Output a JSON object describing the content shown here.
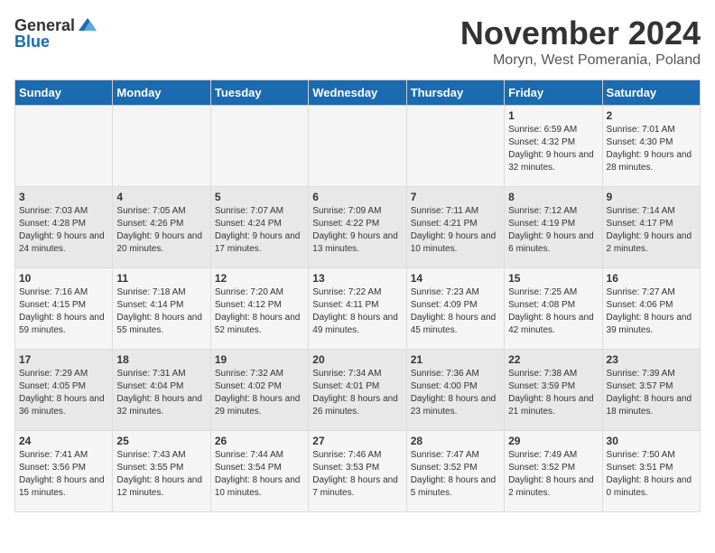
{
  "logo": {
    "text_general": "General",
    "text_blue": "Blue"
  },
  "header": {
    "month_year": "November 2024",
    "location": "Moryn, West Pomerania, Poland"
  },
  "weekdays": [
    "Sunday",
    "Monday",
    "Tuesday",
    "Wednesday",
    "Thursday",
    "Friday",
    "Saturday"
  ],
  "weeks": [
    [
      {
        "day": "",
        "info": ""
      },
      {
        "day": "",
        "info": ""
      },
      {
        "day": "",
        "info": ""
      },
      {
        "day": "",
        "info": ""
      },
      {
        "day": "",
        "info": ""
      },
      {
        "day": "1",
        "info": "Sunrise: 6:59 AM\nSunset: 4:32 PM\nDaylight: 9 hours and 32 minutes."
      },
      {
        "day": "2",
        "info": "Sunrise: 7:01 AM\nSunset: 4:30 PM\nDaylight: 9 hours and 28 minutes."
      }
    ],
    [
      {
        "day": "3",
        "info": "Sunrise: 7:03 AM\nSunset: 4:28 PM\nDaylight: 9 hours and 24 minutes."
      },
      {
        "day": "4",
        "info": "Sunrise: 7:05 AM\nSunset: 4:26 PM\nDaylight: 9 hours and 20 minutes."
      },
      {
        "day": "5",
        "info": "Sunrise: 7:07 AM\nSunset: 4:24 PM\nDaylight: 9 hours and 17 minutes."
      },
      {
        "day": "6",
        "info": "Sunrise: 7:09 AM\nSunset: 4:22 PM\nDaylight: 9 hours and 13 minutes."
      },
      {
        "day": "7",
        "info": "Sunrise: 7:11 AM\nSunset: 4:21 PM\nDaylight: 9 hours and 10 minutes."
      },
      {
        "day": "8",
        "info": "Sunrise: 7:12 AM\nSunset: 4:19 PM\nDaylight: 9 hours and 6 minutes."
      },
      {
        "day": "9",
        "info": "Sunrise: 7:14 AM\nSunset: 4:17 PM\nDaylight: 9 hours and 2 minutes."
      }
    ],
    [
      {
        "day": "10",
        "info": "Sunrise: 7:16 AM\nSunset: 4:15 PM\nDaylight: 8 hours and 59 minutes."
      },
      {
        "day": "11",
        "info": "Sunrise: 7:18 AM\nSunset: 4:14 PM\nDaylight: 8 hours and 55 minutes."
      },
      {
        "day": "12",
        "info": "Sunrise: 7:20 AM\nSunset: 4:12 PM\nDaylight: 8 hours and 52 minutes."
      },
      {
        "day": "13",
        "info": "Sunrise: 7:22 AM\nSunset: 4:11 PM\nDaylight: 8 hours and 49 minutes."
      },
      {
        "day": "14",
        "info": "Sunrise: 7:23 AM\nSunset: 4:09 PM\nDaylight: 8 hours and 45 minutes."
      },
      {
        "day": "15",
        "info": "Sunrise: 7:25 AM\nSunset: 4:08 PM\nDaylight: 8 hours and 42 minutes."
      },
      {
        "day": "16",
        "info": "Sunrise: 7:27 AM\nSunset: 4:06 PM\nDaylight: 8 hours and 39 minutes."
      }
    ],
    [
      {
        "day": "17",
        "info": "Sunrise: 7:29 AM\nSunset: 4:05 PM\nDaylight: 8 hours and 36 minutes."
      },
      {
        "day": "18",
        "info": "Sunrise: 7:31 AM\nSunset: 4:04 PM\nDaylight: 8 hours and 32 minutes."
      },
      {
        "day": "19",
        "info": "Sunrise: 7:32 AM\nSunset: 4:02 PM\nDaylight: 8 hours and 29 minutes."
      },
      {
        "day": "20",
        "info": "Sunrise: 7:34 AM\nSunset: 4:01 PM\nDaylight: 8 hours and 26 minutes."
      },
      {
        "day": "21",
        "info": "Sunrise: 7:36 AM\nSunset: 4:00 PM\nDaylight: 8 hours and 23 minutes."
      },
      {
        "day": "22",
        "info": "Sunrise: 7:38 AM\nSunset: 3:59 PM\nDaylight: 8 hours and 21 minutes."
      },
      {
        "day": "23",
        "info": "Sunrise: 7:39 AM\nSunset: 3:57 PM\nDaylight: 8 hours and 18 minutes."
      }
    ],
    [
      {
        "day": "24",
        "info": "Sunrise: 7:41 AM\nSunset: 3:56 PM\nDaylight: 8 hours and 15 minutes."
      },
      {
        "day": "25",
        "info": "Sunrise: 7:43 AM\nSunset: 3:55 PM\nDaylight: 8 hours and 12 minutes."
      },
      {
        "day": "26",
        "info": "Sunrise: 7:44 AM\nSunset: 3:54 PM\nDaylight: 8 hours and 10 minutes."
      },
      {
        "day": "27",
        "info": "Sunrise: 7:46 AM\nSunset: 3:53 PM\nDaylight: 8 hours and 7 minutes."
      },
      {
        "day": "28",
        "info": "Sunrise: 7:47 AM\nSunset: 3:52 PM\nDaylight: 8 hours and 5 minutes."
      },
      {
        "day": "29",
        "info": "Sunrise: 7:49 AM\nSunset: 3:52 PM\nDaylight: 8 hours and 2 minutes."
      },
      {
        "day": "30",
        "info": "Sunrise: 7:50 AM\nSunset: 3:51 PM\nDaylight: 8 hours and 0 minutes."
      }
    ]
  ]
}
